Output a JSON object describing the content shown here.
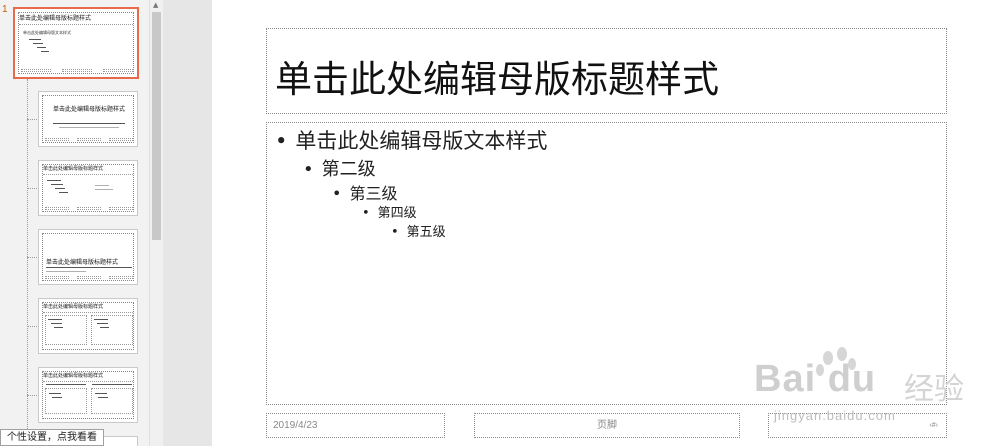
{
  "thumbnails": {
    "selected_number": "1",
    "slide1_title": "单击此处编辑母版标题样式",
    "slide1_body": "单击此处编辑母版文本样式",
    "slide2_title": "单击此处编辑母版标题样式",
    "slide3_title": "单击此处编辑母版标题样式",
    "slide4_title": "单击此处编辑母版标题样式",
    "slide5_title": "单击此处编辑母版标题样式",
    "slide6_title": "单击此处编辑母版标题样式"
  },
  "slide": {
    "title": "单击此处编辑母版标题样式",
    "bullet": "•",
    "levels": [
      "单击此处编辑母版文本样式",
      "第二级",
      "第三级",
      "第四级",
      "第五级"
    ],
    "footer_date": "2019/4/23",
    "footer_text": "页脚",
    "footer_number": "‹#›"
  },
  "watermark": {
    "brand": "Bai du",
    "brand_cn": "经验",
    "url": "jingyan.baidu.com"
  },
  "tooltip": "个性设置，点我看看"
}
